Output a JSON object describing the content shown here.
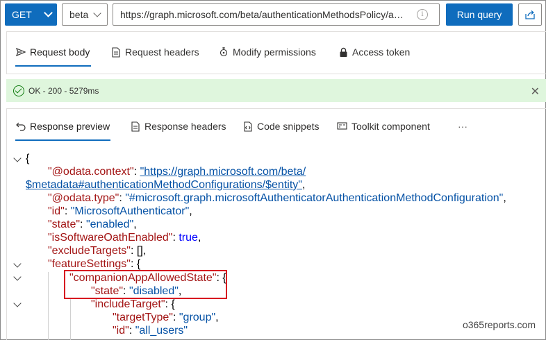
{
  "toolbar": {
    "method": "GET",
    "version": "beta",
    "url": "https://graph.microsoft.com/beta/authenticationMethodsPolicy/authenticationMethodConfigurations/MicrosoftAuthenticator",
    "run_label": "Run query"
  },
  "request_tabs": [
    {
      "label": "Request body",
      "icon": "send-icon"
    },
    {
      "label": "Request headers",
      "icon": "document-icon"
    },
    {
      "label": "Modify permissions",
      "icon": "shield-key-icon"
    },
    {
      "label": "Access token",
      "icon": "lock-icon"
    }
  ],
  "status": {
    "text": "OK - 200 - 5279ms",
    "color": "#dff6dd"
  },
  "response_tabs": [
    {
      "label": "Response preview",
      "icon": "undo-icon"
    },
    {
      "label": "Response headers",
      "icon": "document-icon"
    },
    {
      "label": "Code snippets",
      "icon": "code-snippet-icon"
    },
    {
      "label": "Toolkit component",
      "icon": "toolkit-icon"
    },
    {
      "label": "···",
      "icon": "more-icon"
    }
  ],
  "json": {
    "open": "{",
    "k1": "\"@odata.context\"",
    "v1a": "\"https://graph.microsoft.com/beta/",
    "v1b": "$metadata#authenticationMethodConfigurations/$entity\"",
    "k2": "\"@odata.type\"",
    "v2": "\"#microsoft.graph.microsoftAuthenticatorAuthenticationMethodConfiguration\"",
    "k3": "\"id\"",
    "v3": "\"MicrosoftAuthenticator\"",
    "k4": "\"state\"",
    "v4": "\"enabled\"",
    "k5": "\"isSoftwareOathEnabled\"",
    "v5": "true",
    "k6": "\"excludeTargets\"",
    "v6": "[]",
    "k7": "\"featureSettings\"",
    "k8": "\"companionAppAllowedState\"",
    "k9": "\"state\"",
    "v9": "\"disabled\"",
    "k10": "\"includeTarget\"",
    "k11": "\"targetType\"",
    "v11": "\"group\"",
    "k12": "\"id\"",
    "v12": "\"all_users\""
  },
  "watermark": "o365reports.com",
  "colors": {
    "accent": "#0f6cbd",
    "highlight_box": "#d71920"
  }
}
